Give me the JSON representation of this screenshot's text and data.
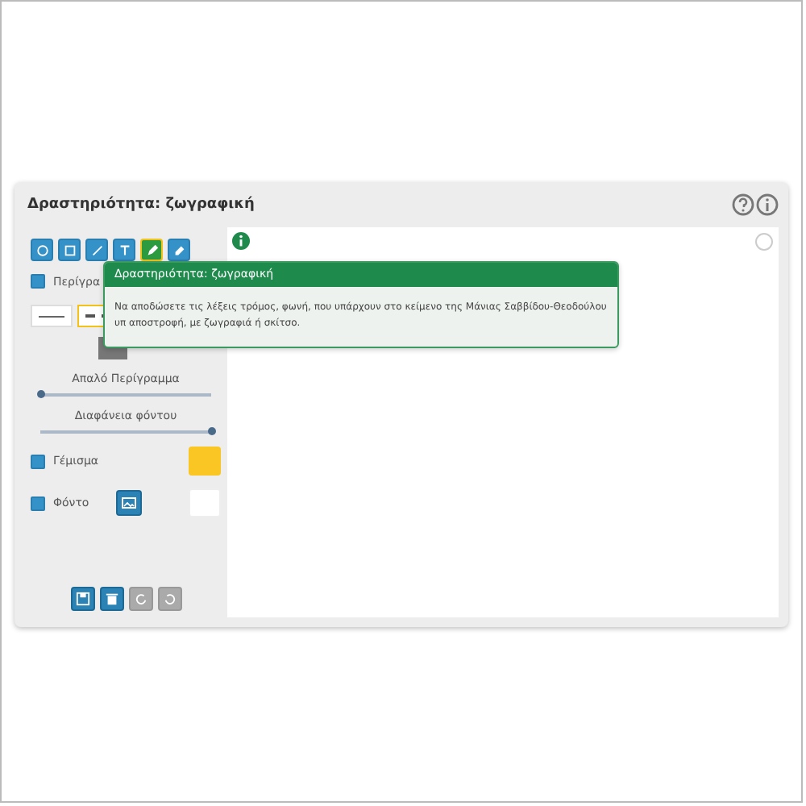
{
  "panel": {
    "title": "Δραστηριότητα: ζωγραφική"
  },
  "tools": [
    {
      "kind": "circle",
      "selected": false
    },
    {
      "kind": "square",
      "selected": false
    },
    {
      "kind": "line",
      "selected": false
    },
    {
      "kind": "text",
      "selected": false
    },
    {
      "kind": "pencil",
      "selected": true
    },
    {
      "kind": "eraser",
      "selected": false
    }
  ],
  "outline": {
    "label": "Περίγρα",
    "checked": true
  },
  "line_styles": [
    {
      "kind": "solid",
      "selected": false
    },
    {
      "kind": "dashed",
      "selected": true
    }
  ],
  "sliders": [
    {
      "label": "Απαλό Περίγραμμα",
      "level": 0
    },
    {
      "label": "Διαφάνεια φόντου",
      "level": 1
    }
  ],
  "fill": {
    "label": "Γέμισμα",
    "checked": true,
    "color": "#f9c623"
  },
  "background": {
    "label": "Φόντο",
    "checked": true,
    "color": "#ffffff"
  },
  "actions": [
    {
      "kind": "save",
      "disabled": false
    },
    {
      "kind": "delete",
      "disabled": false
    },
    {
      "kind": "undo",
      "disabled": true
    },
    {
      "kind": "redo",
      "disabled": true
    }
  ],
  "tooltip": {
    "title": "Δραστηριότητα: ζωγραφική",
    "text": "Να αποδώσετε τις λέξεις τρόμος, φωνή, που υπάρχουν στο κείμενο της Μάνιας Σαββίδου-Θεοδούλου υπ αποστροφή, με ζωγραφιά ή σκίτσο."
  }
}
